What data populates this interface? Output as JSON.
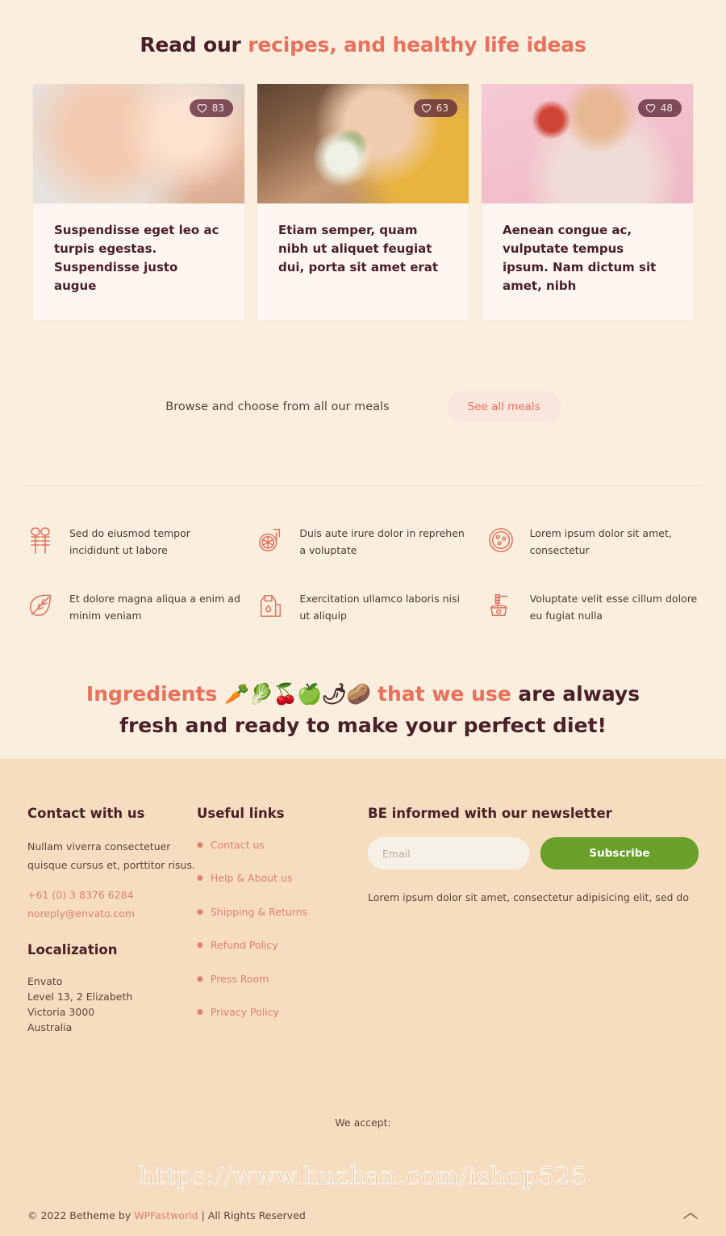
{
  "colors": {
    "page_bg": "#faeede",
    "footer_bg": "#f6ddc0",
    "accent_coral": "#e8715c",
    "heading_dark": "#4a2028",
    "badge_bg": "#5d2838",
    "subscribe_green": "#69a02c",
    "card_bg": "#fdf6f0"
  },
  "blog": {
    "heading_dark": "Read our ",
    "heading_accent": "recipes, and healthy life ideas",
    "cards": [
      {
        "title": "Suspendisse eget leo ac turpis egestas. Suspendisse justo augue",
        "likes": "83",
        "like_icon": "heart-icon",
        "image_alt": "baby being fed with a spoon"
      },
      {
        "title": "Etiam semper, quam nibh ut aliquet feugiat dui, porta sit amet erat",
        "likes": "63",
        "like_icon": "heart-icon",
        "image_alt": "woman eating a salad"
      },
      {
        "title": "Aenean congue ac, vulputate tempus ipsum. Nam dictum sit amet, nibh",
        "likes": "48",
        "like_icon": "heart-icon",
        "image_alt": "woman holding an apple"
      }
    ]
  },
  "browse": {
    "text": "Browse and choose from all our meals",
    "button_label": "See all meals"
  },
  "features": [
    {
      "icon": "wheat-icon",
      "text": "Sed do eiusmod tempor incididunt ut labore"
    },
    {
      "icon": "tomato-slice-icon",
      "text": "Duis aute irure dolor in reprehen a voluptate"
    },
    {
      "icon": "pan-dots-icon",
      "text": "Lorem ipsum dolor sit amet, consectetur"
    },
    {
      "icon": "leaf-icon",
      "text": "Et dolore magna aliqua a enim ad minim veniam"
    },
    {
      "icon": "milk-carton-icon",
      "text": "Exercitation ullamco laboris nisi ut aliquip"
    },
    {
      "icon": "honey-pot-icon",
      "text": "Voluptate velit esse cillum dolore eu fugiat nulla"
    }
  ],
  "ingredients": {
    "line1_accent_a": "Ingredients ",
    "line1_emojis": "🥕🥬🍒🍏🌶🥔",
    "line1_accent_b": " that we use ",
    "line1_dark": "are always",
    "line2": "fresh and ready to make your perfect diet!"
  },
  "footer": {
    "contact": {
      "heading": "Contact with us",
      "paragraph": "Nullam viverra consectetuer quisque cursus et, porttitor risus.",
      "phone": "+61 (0) 3 8376 6284",
      "email": "noreply@envato.com"
    },
    "localization": {
      "heading": "Localization",
      "lines": [
        "Envato",
        "Level 13, 2 Elizabeth",
        "Victoria 3000",
        "Australia"
      ]
    },
    "useful_links": {
      "heading": "Useful links",
      "items": [
        "Contact us",
        "Help & About us",
        "Shipping & Returns",
        "Refund Policy",
        "Press Room",
        "Privacy Policy"
      ]
    },
    "newsletter": {
      "heading": "BE informed with our newsletter",
      "email_placeholder": "Email",
      "email_value": "",
      "button_label": "Subscribe",
      "note": "Lorem ipsum dolor sit amet, consectetur adipisicing elit, sed do"
    },
    "we_accept": "We accept:",
    "copyright_pre": "© 2022 Betheme by ",
    "copyright_brand": "WPFastworld",
    "copyright_post": " | All Rights Reserved",
    "to_top_icon": "chevron-up-icon"
  },
  "watermark": "https://www.huzhan.com/ishop525"
}
